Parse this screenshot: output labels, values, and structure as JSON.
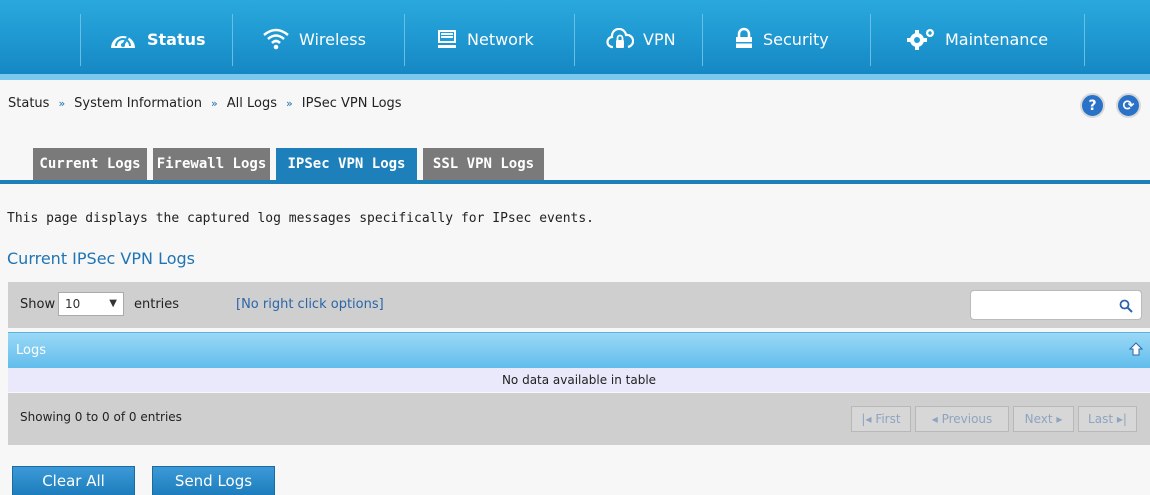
{
  "nav": {
    "items": [
      {
        "label": "Status",
        "icon": "dashboard-icon"
      },
      {
        "label": "Wireless",
        "icon": "wifi-icon"
      },
      {
        "label": "Network",
        "icon": "monitor-icon"
      },
      {
        "label": "VPN",
        "icon": "cloud-lock-icon"
      },
      {
        "label": "Security",
        "icon": "lock-icon"
      },
      {
        "label": "Maintenance",
        "icon": "gears-icon"
      }
    ],
    "active": "Status"
  },
  "breadcrumb": {
    "items": [
      "Status",
      "System Information",
      "All Logs",
      "IPSec VPN Logs"
    ],
    "separator": "»"
  },
  "header_buttons": {
    "help": "?",
    "refresh": "⟳"
  },
  "tabs": [
    {
      "label": "Current Logs"
    },
    {
      "label": "Firewall Logs"
    },
    {
      "label": "IPSec VPN Logs"
    },
    {
      "label": "SSL VPN Logs"
    }
  ],
  "active_tab": "IPSec VPN Logs",
  "description": "This page displays the captured log messages specifically for IPsec events.",
  "section_title": "Current IPSec VPN Logs",
  "table": {
    "show_label": "Show",
    "page_size": "10",
    "entries_label": "entries",
    "right_click_note": "[No right click options]",
    "search_value": "",
    "column_header": "Logs",
    "empty_message": "No data available in table",
    "info": "Showing 0 to 0 of 0 entries",
    "pagination": {
      "first": "First",
      "previous": "Previous",
      "next": "Next",
      "last": "Last"
    }
  },
  "actions": {
    "clear_all": "Clear All",
    "send_logs": "Send Logs"
  },
  "colors": {
    "brand_blue": "#1a9fd8",
    "tab_active": "#1e80bb",
    "tab_inactive": "#7a7a7a",
    "link_blue": "#2b65a8"
  }
}
